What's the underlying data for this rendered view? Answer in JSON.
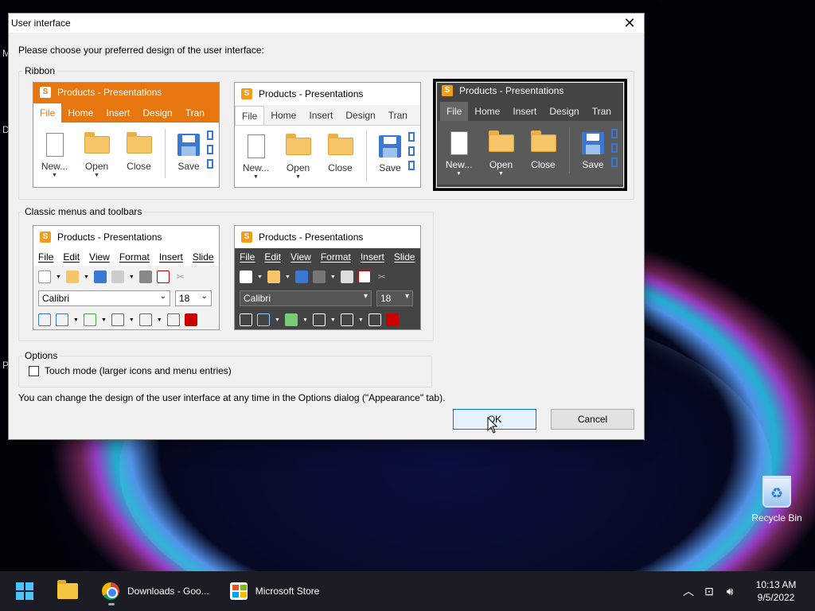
{
  "dialog": {
    "title": "User interface",
    "prompt": "Please choose your preferred design of the user interface:",
    "ribbon_label": "Ribbon",
    "classic_label": "Classic menus and toolbars",
    "options_label": "Options",
    "touch_mode_label": "Touch mode (larger icons and menu entries)",
    "touch_mode_checked": false,
    "footnote": "You can change the design of the user interface at any time in the Options dialog (\"Appearance\" tab).",
    "ok_label": "OK",
    "cancel_label": "Cancel"
  },
  "previews": {
    "window_title": "Products - Presentations",
    "app_letter": "S",
    "ribbon_tabs": [
      "File",
      "Home",
      "Insert",
      "Design",
      "Tran"
    ],
    "ribbon_buttons": [
      "New...",
      "Open",
      "Close",
      "Save"
    ],
    "menu_items": [
      "File",
      "Edit",
      "View",
      "Format",
      "Insert",
      "Slide"
    ],
    "font_name": "Calibri",
    "font_size": "18",
    "selected_style": "ribbon-dark"
  },
  "colors": {
    "accent_orange": "#e8760e",
    "dark_bg": "#444444",
    "selection_border": "#000000",
    "ok_border": "#0078d7"
  },
  "desktop": {
    "recycle_bin_label": "Recycle Bin",
    "fragment_1": "M",
    "fragment_2": "D",
    "fragment_3": "P"
  },
  "taskbar": {
    "chrome_label": "Downloads - Goo...",
    "store_label": "Microsoft Store",
    "time": "10:13 AM",
    "date": "9/5/2022"
  }
}
